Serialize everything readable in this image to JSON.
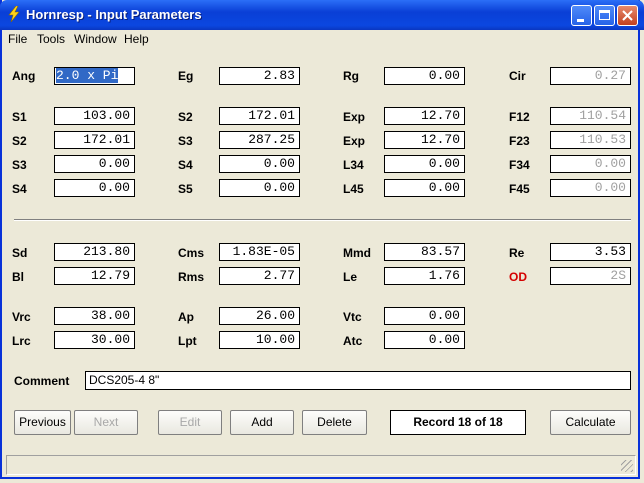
{
  "window": {
    "title": "Hornresp - Input Parameters"
  },
  "menu": [
    "File",
    "Tools",
    "Window",
    "Help"
  ],
  "params": {
    "Ang": "2.0 x Pi",
    "Eg": "2.83",
    "Rg": "0.00",
    "Cir": "0.27",
    "S1": "103.00",
    "S2a": "172.01",
    "Exp1": "12.70",
    "F12": "110.54",
    "S2": "172.01",
    "S3a": "287.25",
    "Exp2": "12.70",
    "F23": "110.53",
    "S3": "0.00",
    "S4a": "0.00",
    "L34": "0.00",
    "F34": "0.00",
    "S4": "0.00",
    "S5": "0.00",
    "L45": "0.00",
    "F45": "0.00",
    "Sd": "213.80",
    "Cms": "1.83E-05",
    "Mmd": "83.57",
    "Re": "3.53",
    "Bl": "12.79",
    "Rms": "2.77",
    "Le": "1.76",
    "OD": "2S",
    "Vrc": "38.00",
    "Ap": "26.00",
    "Vtc": "0.00",
    "Lrc": "30.00",
    "Lpt": "10.00",
    "Atc": "0.00"
  },
  "labels": {
    "Ang": "Ang",
    "Eg": "Eg",
    "Rg": "Rg",
    "Cir": "Cir",
    "S1": "S1",
    "S2a": "S2",
    "Exp1": "Exp",
    "F12": "F12",
    "S2": "S2",
    "S3a": "S3",
    "Exp2": "Exp",
    "F23": "F23",
    "S3": "S3",
    "S4a": "S4",
    "L34": "L34",
    "F34": "F34",
    "S4": "S4",
    "S5": "S5",
    "L45": "L45",
    "F45": "F45",
    "Sd": "Sd",
    "Cms": "Cms",
    "Mmd": "Mmd",
    "Re": "Re",
    "Bl": "Bl",
    "Rms": "Rms",
    "Le": "Le",
    "OD": "OD",
    "Vrc": "Vrc",
    "Ap": "Ap",
    "Vtc": "Vtc",
    "Lrc": "Lrc",
    "Lpt": "Lpt",
    "Atc": "Atc",
    "Comment": "Comment"
  },
  "comment": "DCS205-4 8\"",
  "buttons": {
    "previous": "Previous",
    "next": "Next",
    "edit": "Edit",
    "add": "Add",
    "delete": "Delete",
    "calculate": "Calculate"
  },
  "record": "Record 18 of 18",
  "colors": {
    "title_bar": "#0a3fd6",
    "od_label": "#d40000",
    "selection": "#3169c6"
  }
}
